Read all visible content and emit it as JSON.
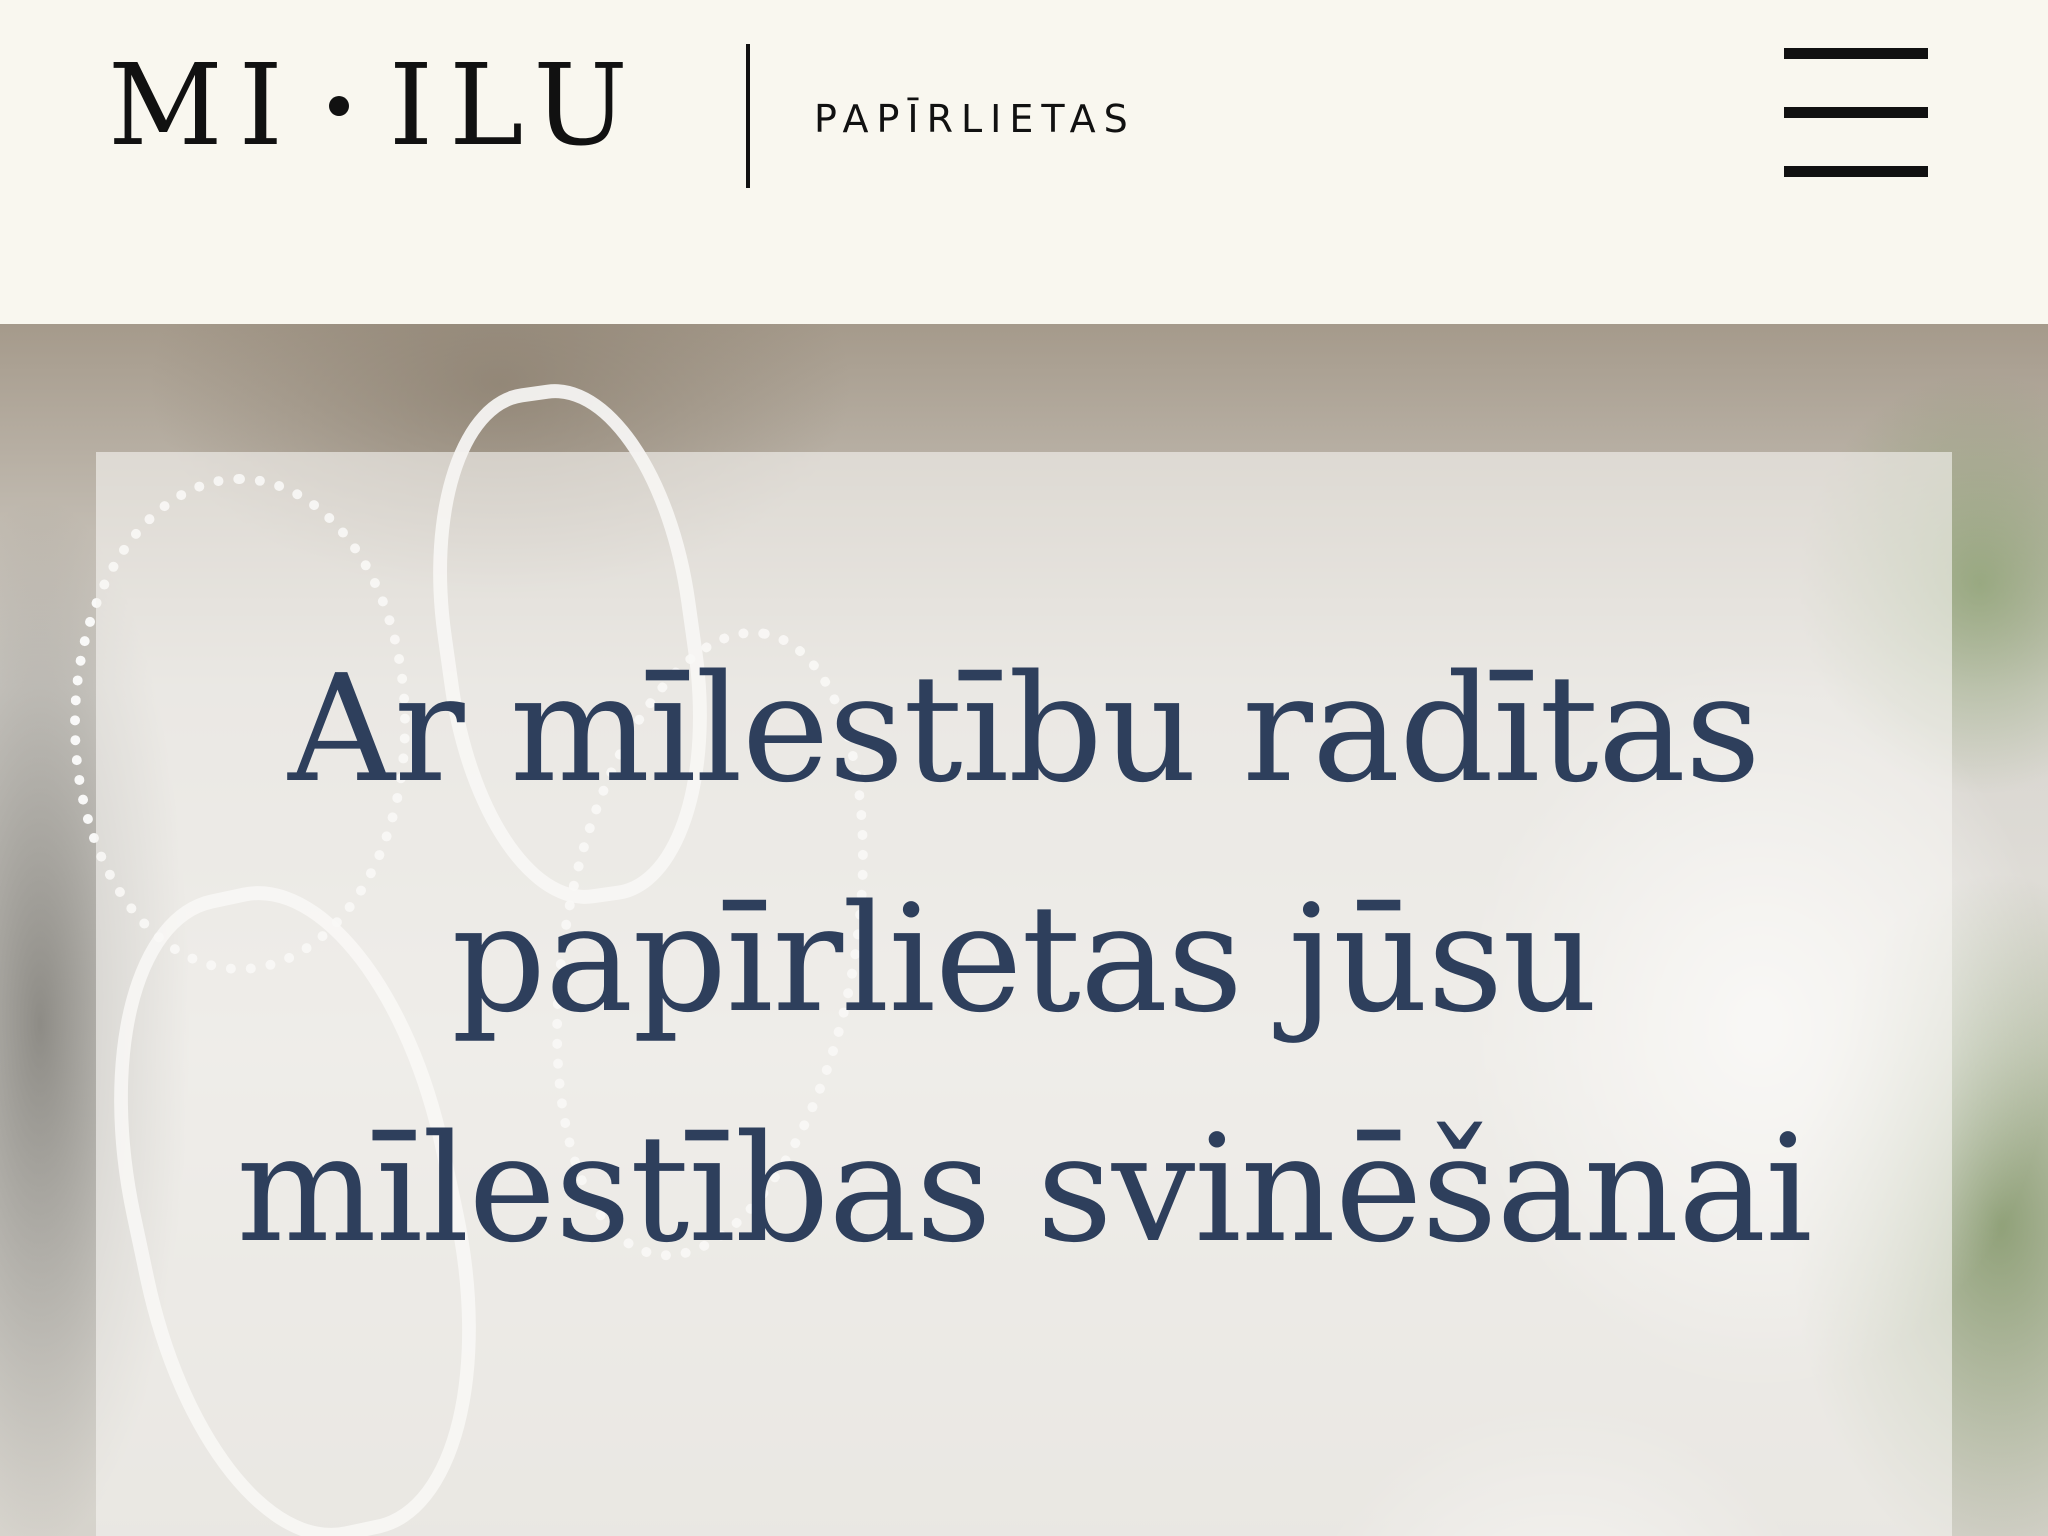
{
  "header": {
    "logo_left": "MI",
    "logo_right": "ILU",
    "tagline": "PAPĪRLIETAS",
    "menu_icon": "hamburger-menu-icon"
  },
  "hero": {
    "heading": "Ar mīlestību radītas papīrlietas jūsu mīlestības svinēšanai"
  },
  "colors": {
    "background": "#f9f7ef",
    "text_dark": "#111111",
    "heading": "#2e3f5c"
  }
}
